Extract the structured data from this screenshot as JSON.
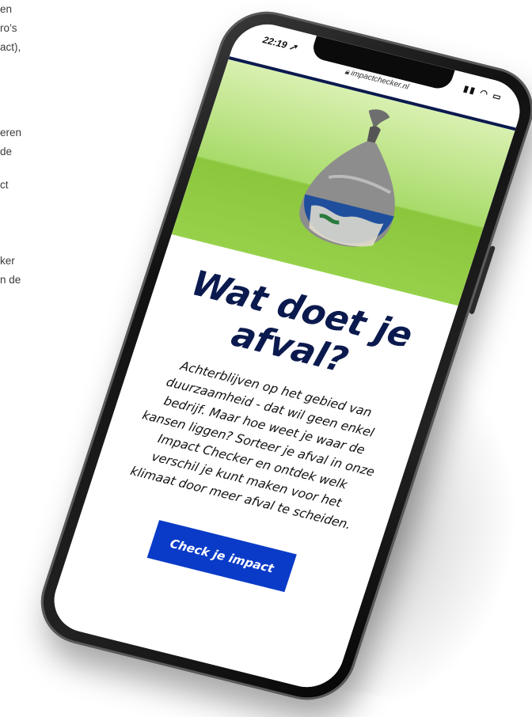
{
  "left_fragments": [
    "en",
    "ro’s",
    "act),",
    "eren",
    "de",
    "ct",
    "ker",
    "n de"
  ],
  "status": {
    "time": "22:19",
    "icons": "▮▮ ◠ ▭"
  },
  "browser": {
    "url": "impactchecker.nl"
  },
  "main": {
    "title": "Wat doet je afval?",
    "body": "Achterblijven op het gebied van duurzaamheid - dat wil geen enkel bedrijf. Maar hoe weet je waar de kansen liggen? Sorteer je afval in onze Impact Checker en ontdek welk verschil je kunt maken voor het klimaat door meer afval te scheiden.",
    "cta_label": "Check je impact"
  },
  "colors": {
    "navy": "#0b1a4e",
    "green": "#8bc63d",
    "cta_blue": "#0a3bc8"
  },
  "icons": [
    "lock-icon",
    "signal-icon",
    "wifi-icon",
    "battery-icon",
    "location-arrow-icon"
  ]
}
